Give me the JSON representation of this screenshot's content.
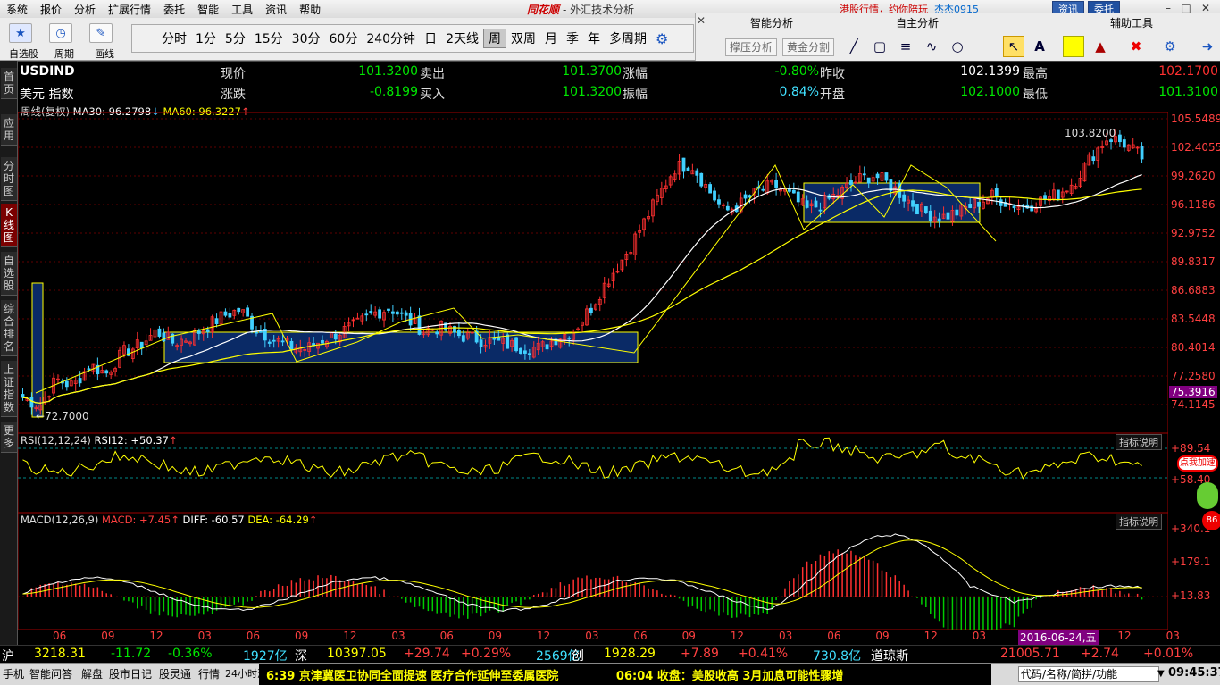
{
  "menu": [
    "系统",
    "报价",
    "分析",
    "扩展行情",
    "委托",
    "智能",
    "工具",
    "资讯",
    "帮助"
  ],
  "app": {
    "logo": "同花顺",
    "subtitle": "- 外汇技术分析",
    "promo": "港股行情，约你陪玩",
    "user": "杰杰0915",
    "news_btn": "资讯",
    "trade_btn": "委托"
  },
  "toolbar": {
    "watchlist_label": "自选股",
    "period_label": "周期",
    "draw_label": "画线",
    "periods": [
      "分时",
      "1分",
      "5分",
      "15分",
      "30分",
      "60分",
      "240分钟",
      "日",
      "2天线",
      "周",
      "双周",
      "月",
      "季",
      "年",
      "多周期"
    ],
    "active_period": "周",
    "smart_title": "智能分析",
    "own_title": "自主分析",
    "aux_title": "辅助工具",
    "smart_btns": [
      "撑压分析",
      "黄金分割"
    ]
  },
  "sidebar": [
    "首页",
    "应用",
    "分时图",
    "K线图",
    "自选股",
    "综合排名",
    "上证指数",
    "更多"
  ],
  "quote": {
    "symbol": "USDIND",
    "name": "美元 指数",
    "rows": [
      [
        {
          "l": "现价",
          "v": "101.3200",
          "c": "g"
        },
        {
          "l": "卖出",
          "v": "101.3700",
          "c": "g"
        },
        {
          "l": "涨幅",
          "v": "-0.80%",
          "c": "g"
        },
        {
          "l": "昨收",
          "v": "102.1399",
          "c": "w"
        },
        {
          "l": "最高",
          "v": "102.1700",
          "c": "r"
        }
      ],
      [
        {
          "l": "涨跌",
          "v": "-0.8199",
          "c": "g"
        },
        {
          "l": "买入",
          "v": "101.3200",
          "c": "g"
        },
        {
          "l": "振幅",
          "v": "0.84%",
          "c": "c"
        },
        {
          "l": "开盘",
          "v": "102.1000",
          "c": "g"
        },
        {
          "l": "最低",
          "v": "101.3100",
          "c": "g"
        }
      ]
    ]
  },
  "main_indicator": {
    "label": "周线(复权)",
    "ma30": "MA30: 96.2798",
    "ma60": "MA60: 96.3227"
  },
  "y_axis": [
    "105.5489",
    "102.4055",
    "99.2620",
    "96.1186",
    "92.9752",
    "89.8317",
    "86.6883",
    "83.5448",
    "80.4014",
    "77.2580",
    "74.1145"
  ],
  "current_price_tag": "75.3916",
  "high_label": "103.8200",
  "low_label": "72.7000",
  "rsi": {
    "label": "RSI(12,12,24)",
    "rsi12": "RSI12: +50.37",
    "levels": [
      "+89.54",
      "+58.40"
    ],
    "btn": "指标说明"
  },
  "macd": {
    "label": "MACD(12,26,9)",
    "macd": "MACD: +7.45",
    "diff": "DIFF: -60.57",
    "dea": "DEA: -64.29",
    "levels": [
      "+340.1",
      "+179.1",
      "+13.83"
    ],
    "btn": "指标说明"
  },
  "x_axis": [
    "06",
    "09",
    "12",
    "03",
    "06",
    "09",
    "12",
    "03",
    "06",
    "09",
    "12",
    "03",
    "06",
    "09",
    "12",
    "03",
    "06",
    "09",
    "12",
    "03",
    "06",
    "09",
    "12",
    "03"
  ],
  "cursor_date": "2016-06-24,五",
  "promo_badge": "点我加速",
  "ticker": [
    {
      "name": "沪",
      "v1": "3218.31",
      "v2": "-11.72",
      "v3": "-0.36%",
      "amt": "1927亿"
    },
    {
      "name": "深",
      "v1": "10397.05",
      "v2": "+29.74",
      "v3": "+0.29%",
      "amt": "2569亿"
    },
    {
      "name": "创",
      "v1": "1928.29",
      "v2": "+7.89",
      "v3": "+0.41%",
      "amt": "730.8亿"
    },
    {
      "name": "道琼斯",
      "v1": "21005.71",
      "v2": "+2.74",
      "v3": "+0.01%",
      "amt": ""
    }
  ],
  "status": {
    "tabs": [
      "手机",
      "智能问答",
      "解盘",
      "股市日记",
      "股灵通",
      "行情",
      "24小时滚动"
    ],
    "news1": "6:39 京津冀医卫协同全面提速 医疗合作延伸至委属医院",
    "news2": "06:04 收盘：美股收高 3月加息可能性骤增",
    "search_placeholder": "代码/名称/简拼/功能",
    "clock": "09:45:37"
  },
  "chart_data": {
    "type": "candlestick",
    "title": "USDIND 周线",
    "ylim": [
      72.0,
      105.6
    ],
    "x_ticks": [
      "06",
      "09",
      "12",
      "03",
      "06",
      "09",
      "12",
      "03",
      "06",
      "09",
      "12",
      "03",
      "06",
      "09",
      "12",
      "03",
      "06",
      "09",
      "12",
      "03",
      "06",
      "09",
      "12",
      "03"
    ],
    "close_path": [
      74.5,
      73.6,
      76.5,
      75.8,
      78.1,
      77.2,
      79.5,
      80.3,
      81.9,
      80.6,
      81.2,
      82.4,
      83.6,
      84.3,
      82.1,
      81.0,
      80.2,
      79.9,
      81.0,
      81.8,
      82.6,
      83.9,
      84.5,
      83.2,
      82.0,
      82.3,
      81.5,
      81.1,
      80.8,
      80.4,
      80.1,
      80.0,
      81.2,
      82.0,
      84.5,
      87.6,
      90.2,
      93.4,
      96.8,
      100.1,
      100.6,
      97.8,
      95.2,
      96.1,
      97.5,
      98.2,
      96.9,
      95.4,
      96.3,
      97.5,
      98.8,
      99.3,
      98.1,
      96.5,
      95.1,
      94.6,
      95.2,
      96.1,
      97.0,
      96.2,
      95.8,
      96.5,
      97.2,
      98.7,
      101.5,
      103.6,
      102.8,
      101.3
    ]
  }
}
